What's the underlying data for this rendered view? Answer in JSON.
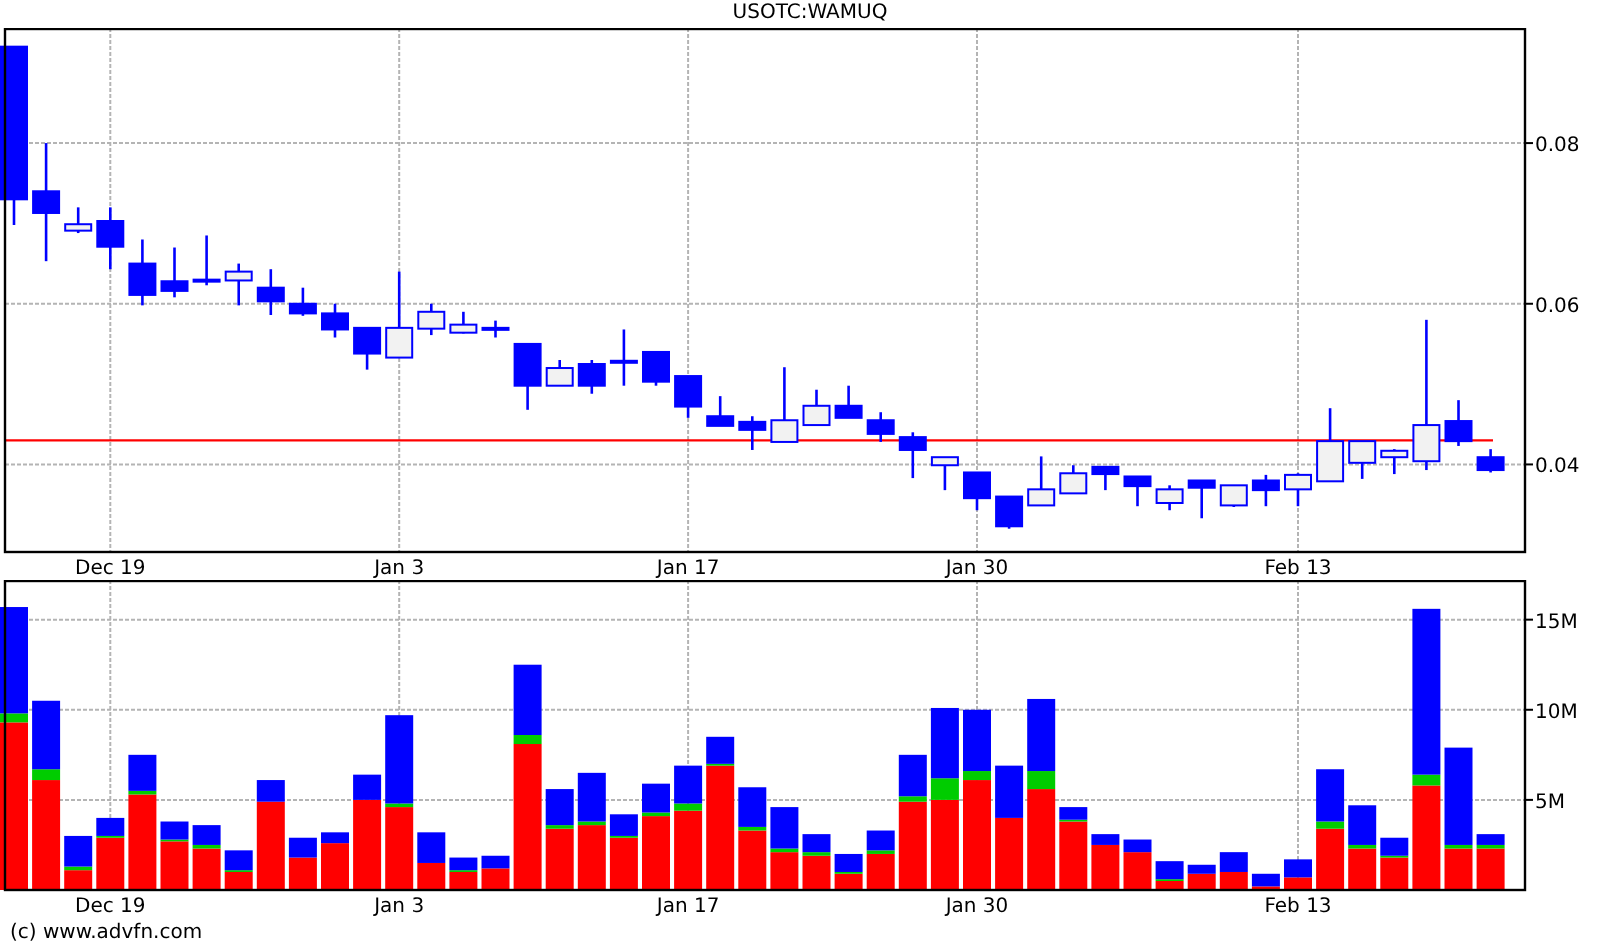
{
  "price_chart": {
    "chart_data": {
      "type": "candlestick",
      "title": "USOTC:WAMUQ",
      "categories": [
        null,
        null,
        null,
        "Dec 19",
        null,
        null,
        null,
        null,
        null,
        null,
        null,
        null,
        "Jan 3",
        null,
        null,
        null,
        null,
        null,
        null,
        null,
        null,
        "Jan 17",
        null,
        null,
        null,
        null,
        null,
        null,
        null,
        null,
        "Jan 30",
        null,
        null,
        null,
        null,
        null,
        null,
        null,
        null,
        null,
        "Feb 13",
        null,
        null,
        null,
        null,
        null,
        null
      ],
      "grid": true,
      "ylim": [
        0.0291,
        0.0942
      ],
      "yticks": [
        0.04,
        0.06,
        0.08
      ],
      "ohlc": [
        [
          0.092,
          0.092,
          0.0698,
          0.073
        ],
        [
          0.074,
          0.08,
          0.0653,
          0.0713
        ],
        [
          0.0691,
          0.072,
          0.0688,
          0.0699
        ],
        [
          0.0703,
          0.072,
          0.0643,
          0.0671
        ],
        [
          0.065,
          0.068,
          0.0598,
          0.0611
        ],
        [
          0.0628,
          0.067,
          0.0608,
          0.0616
        ],
        [
          0.063,
          0.0685,
          0.0623,
          0.0628
        ],
        [
          0.0629,
          0.065,
          0.0598,
          0.064
        ],
        [
          0.062,
          0.0643,
          0.0586,
          0.0603
        ],
        [
          0.06,
          0.062,
          0.0585,
          0.0588
        ],
        [
          0.0588,
          0.06,
          0.0558,
          0.0568
        ],
        [
          0.057,
          0.057,
          0.0518,
          0.0538
        ],
        [
          0.0533,
          0.064,
          0.0533,
          0.057
        ],
        [
          0.0569,
          0.06,
          0.0561,
          0.059
        ],
        [
          0.0564,
          0.059,
          0.0563,
          0.0574
        ],
        [
          0.057,
          0.0579,
          0.0558,
          0.057
        ],
        [
          0.055,
          0.055,
          0.0468,
          0.0498
        ],
        [
          0.0498,
          0.053,
          0.0498,
          0.052
        ],
        [
          0.0525,
          0.053,
          0.0488,
          0.0498
        ],
        [
          0.0529,
          0.0568,
          0.0498,
          0.0529
        ],
        [
          0.054,
          0.054,
          0.0498,
          0.0503
        ],
        [
          0.051,
          0.051,
          0.0458,
          0.0472
        ],
        [
          0.046,
          0.0485,
          0.0448,
          0.0448
        ],
        [
          0.0453,
          0.046,
          0.0418,
          0.0443
        ],
        [
          0.0428,
          0.0521,
          0.0428,
          0.0455
        ],
        [
          0.0449,
          0.0493,
          0.0449,
          0.0473
        ],
        [
          0.0473,
          0.0498,
          0.0458,
          0.0458
        ],
        [
          0.0455,
          0.0465,
          0.0428,
          0.0438
        ],
        [
          0.0434,
          0.044,
          0.0383,
          0.0418
        ],
        [
          0.0399,
          0.0409,
          0.0368,
          0.0409
        ],
        [
          0.039,
          0.039,
          0.0343,
          0.0358
        ],
        [
          0.036,
          0.036,
          0.032,
          0.0323
        ],
        [
          0.0349,
          0.041,
          0.0349,
          0.0369
        ],
        [
          0.0364,
          0.0399,
          0.0364,
          0.0389
        ],
        [
          0.0397,
          0.0397,
          0.0368,
          0.0388
        ],
        [
          0.0385,
          0.0385,
          0.0348,
          0.0373
        ],
        [
          0.0352,
          0.0374,
          0.0343,
          0.0369
        ],
        [
          0.038,
          0.038,
          0.0333,
          0.0371
        ],
        [
          0.0349,
          0.0374,
          0.0347,
          0.0374
        ],
        [
          0.038,
          0.0387,
          0.0348,
          0.0368
        ],
        [
          0.0369,
          0.0389,
          0.0348,
          0.0387
        ],
        [
          0.0379,
          0.047,
          0.0379,
          0.0429
        ],
        [
          0.0402,
          0.0429,
          0.0382,
          0.0429
        ],
        [
          0.0409,
          0.0419,
          0.0388,
          0.0417
        ],
        [
          0.0404,
          0.058,
          0.0393,
          0.0449
        ],
        [
          0.0454,
          0.048,
          0.0423,
          0.0429
        ],
        [
          0.0409,
          0.0419,
          0.039,
          0.0393
        ]
      ],
      "ref_lines": [
        {
          "axis": "y",
          "value": 0.043,
          "color": "#ff0000"
        }
      ]
    }
  },
  "volume_chart": {
    "chart_data": {
      "type": "bar",
      "stacked": true,
      "grid": true,
      "categories": [
        null,
        null,
        null,
        "Dec 19",
        null,
        null,
        null,
        null,
        null,
        null,
        null,
        null,
        "Jan 3",
        null,
        null,
        null,
        null,
        null,
        null,
        null,
        null,
        "Jan 17",
        null,
        null,
        null,
        null,
        null,
        null,
        null,
        null,
        "Jan 30",
        null,
        null,
        null,
        null,
        null,
        null,
        null,
        null,
        null,
        "Feb 13",
        null,
        null,
        null,
        null,
        null,
        null
      ],
      "ylim": [
        0,
        17200000
      ],
      "yticks": [
        {
          "value": 5000000,
          "label": "5M"
        },
        {
          "value": 10000000,
          "label": "10M"
        },
        {
          "value": 15000000,
          "label": "15M"
        }
      ],
      "series": [
        {
          "color": "#ff0000",
          "values": [
            9300000,
            6100000,
            1100000,
            2900000,
            5300000,
            2700000,
            2300000,
            1000000,
            4900000,
            1800000,
            2600000,
            5000000,
            4600000,
            1500000,
            1000000,
            1200000,
            8100000,
            3400000,
            3600000,
            2900000,
            4100000,
            4400000,
            6900000,
            3300000,
            2100000,
            1900000,
            900000,
            2000000,
            4900000,
            5000000,
            6100000,
            4000000,
            5600000,
            3800000,
            2500000,
            2100000,
            500000,
            900000,
            1000000,
            200000,
            700000,
            3400000,
            2300000,
            1800000,
            5800000,
            2300000,
            2300000
          ]
        },
        {
          "color": "#00cc00",
          "values": [
            500000,
            600000,
            200000,
            100000,
            200000,
            100000,
            200000,
            100000,
            0,
            0,
            0,
            0,
            200000,
            0,
            100000,
            0,
            500000,
            200000,
            200000,
            100000,
            200000,
            400000,
            100000,
            200000,
            200000,
            200000,
            100000,
            200000,
            300000,
            1200000,
            500000,
            0,
            1000000,
            100000,
            0,
            0,
            100000,
            0,
            0,
            0,
            0,
            400000,
            200000,
            100000,
            600000,
            200000,
            200000
          ]
        },
        {
          "color": "#0000ff",
          "values": [
            5900000,
            3800000,
            1700000,
            1000000,
            2000000,
            1000000,
            1100000,
            1100000,
            1200000,
            1100000,
            600000,
            1400000,
            4900000,
            1700000,
            700000,
            700000,
            3900000,
            2000000,
            2700000,
            1200000,
            1600000,
            2100000,
            1500000,
            2200000,
            2300000,
            1000000,
            1000000,
            1100000,
            2300000,
            3900000,
            3400000,
            2900000,
            4000000,
            700000,
            600000,
            700000,
            1000000,
            500000,
            1100000,
            700000,
            1000000,
            2900000,
            2200000,
            1000000,
            9200000,
            5400000,
            600000
          ]
        }
      ]
    }
  },
  "footer": {
    "copyright": "(c) www.advfn.com"
  }
}
